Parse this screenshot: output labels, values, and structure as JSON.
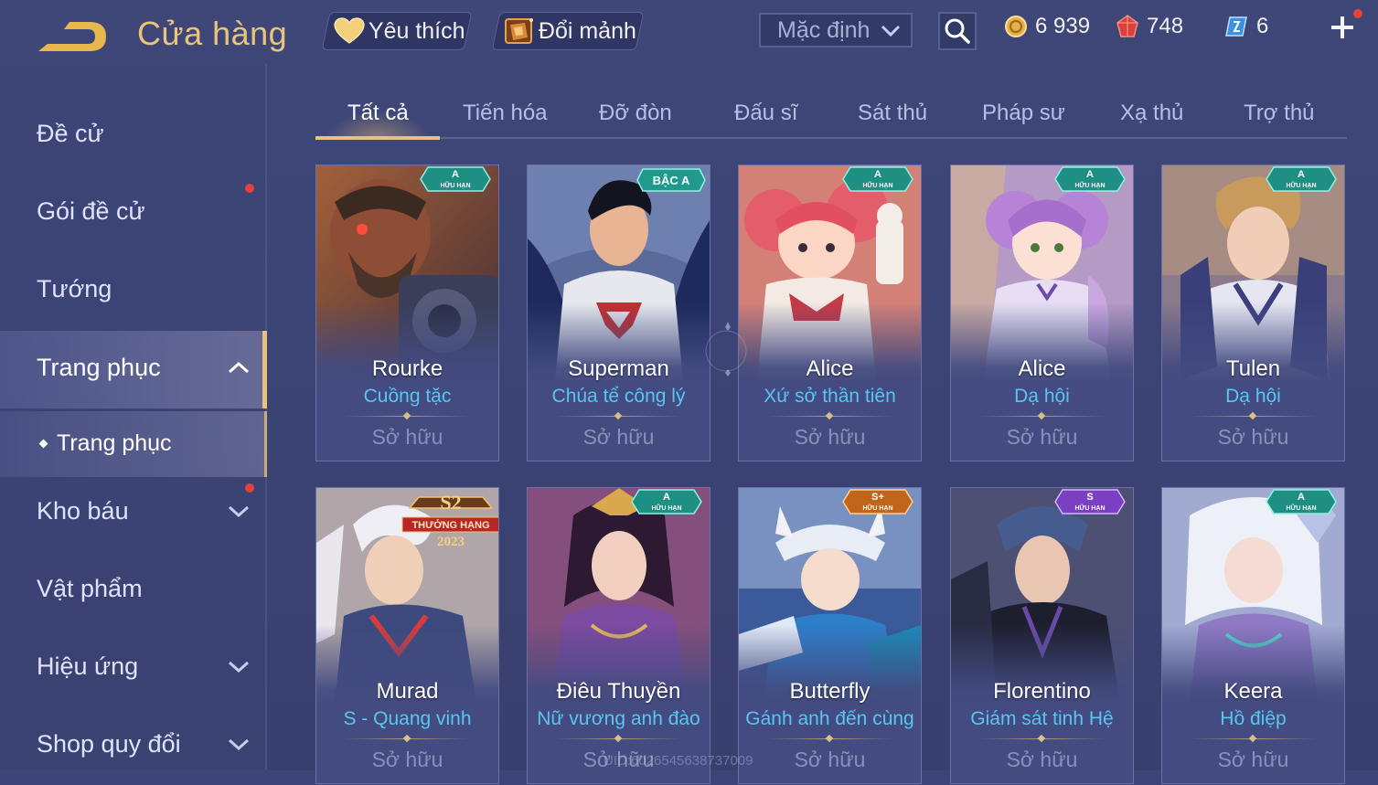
{
  "header": {
    "title": "Cửa hàng",
    "favorite_label": "Yêu thích",
    "shard_label": "Đổi mảnh",
    "sort_value": "Mặc định",
    "currencies": [
      {
        "icon": "gold-coin-icon",
        "value": "6 939"
      },
      {
        "icon": "ruby-gem-icon",
        "value": "748"
      },
      {
        "icon": "voucher-icon",
        "value": "6"
      }
    ]
  },
  "sidebar": {
    "items": [
      {
        "label": "Đề cử"
      },
      {
        "label": "Gói đề cử"
      },
      {
        "label": "Tướng"
      },
      {
        "label": "Trang phục"
      },
      {
        "label": "Kho báu"
      },
      {
        "label": "Vật phẩm"
      },
      {
        "label": "Hiệu ứng"
      },
      {
        "label": "Shop quy đổi"
      }
    ],
    "sub_item": "Trang phục"
  },
  "tabs": [
    "Tất cả",
    "Tiến hóa",
    "Đỡ đòn",
    "Đấu sĩ",
    "Sát thủ",
    "Pháp sư",
    "Xạ thủ",
    "Trợ thủ"
  ],
  "cards": [
    {
      "hero": "Rourke",
      "skin": "Cuồng tặc",
      "status": "Sở hữu",
      "badge": {
        "tier": "A",
        "label": "HỮU HẠN"
      }
    },
    {
      "hero": "Superman",
      "skin": "Chúa tể công lý",
      "status": "Sở hữu",
      "badge": {
        "tier": "BẬC A",
        "label": ""
      }
    },
    {
      "hero": "Alice",
      "skin": "Xứ sở thần tiên",
      "status": "Sở hữu",
      "badge": {
        "tier": "A",
        "label": "HỮU HẠN"
      }
    },
    {
      "hero": "Alice",
      "skin": "Dạ hội",
      "status": "Sở hữu",
      "badge": {
        "tier": "A",
        "label": "HỮU HẠN"
      }
    },
    {
      "hero": "Tulen",
      "skin": "Dạ hội",
      "status": "Sở hữu",
      "badge": {
        "tier": "A",
        "label": "HỮU HẠN"
      }
    },
    {
      "hero": "Murad",
      "skin": "S - Quang vinh",
      "status": "Sở hữu",
      "badge": {
        "tier": "S2",
        "label": "THƯỞNG HẠNG",
        "year": "2023"
      }
    },
    {
      "hero": "Điêu Thuyền",
      "skin": "Nữ vương anh đào",
      "status": "Sở hữu",
      "badge": {
        "tier": "A",
        "label": "HỮU HẠN"
      }
    },
    {
      "hero": "Butterfly",
      "skin": "Gánh anh đến cùng",
      "status": "Sở hữu",
      "badge": {
        "tier": "S+",
        "label": "HỮU HẠN"
      }
    },
    {
      "hero": "Florentino",
      "skin": "Giám sát tinh Hệ",
      "status": "Sở hữu",
      "badge": {
        "tier": "S",
        "label": "HỮU HẠN"
      }
    },
    {
      "hero": "Keera",
      "skin": "Hồ điệp",
      "status": "Sở hữu",
      "badge": {
        "tier": "A",
        "label": "HỮU HẠN"
      }
    }
  ],
  "uid_watermark": "UID:6026545638737009"
}
